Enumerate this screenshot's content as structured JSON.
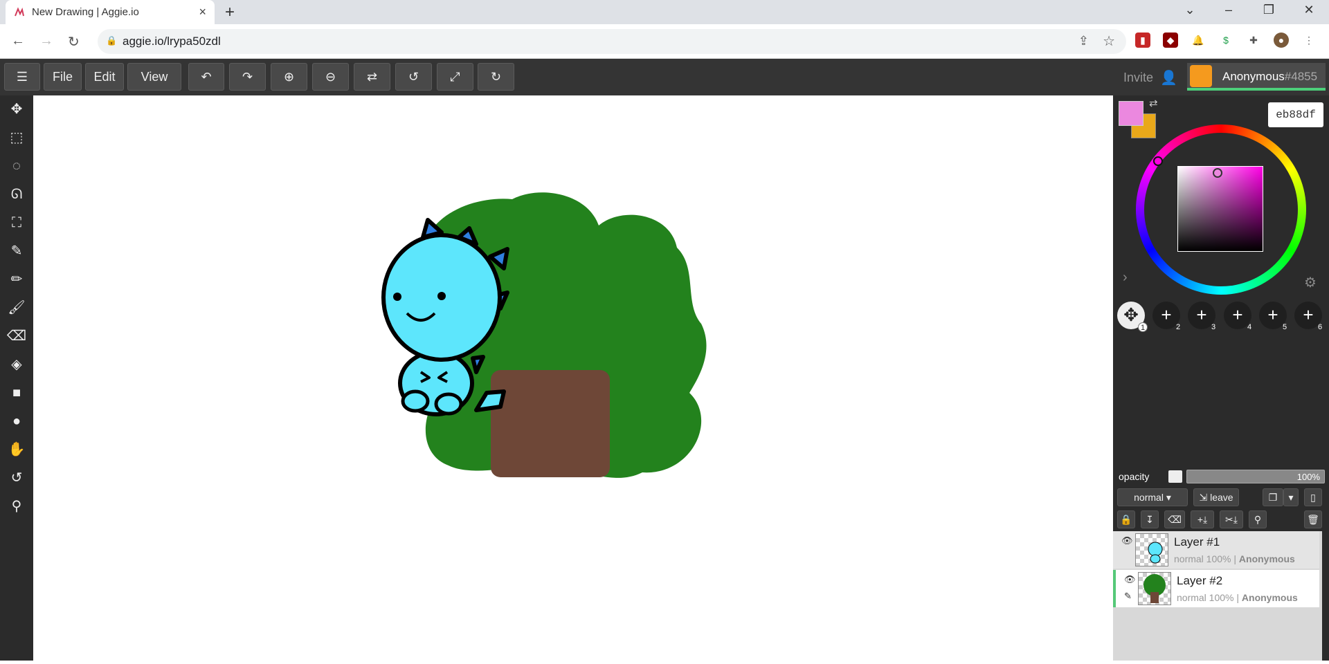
{
  "browser": {
    "tab_title": "New Drawing | Aggie.io",
    "tab_close": "×",
    "new_tab": "+",
    "window_controls": [
      "⌄",
      "–",
      "❐",
      "✕"
    ],
    "url": "aggie.io/lrypa50zdl"
  },
  "toolbar": {
    "menu_icon": "☰",
    "file": "File",
    "edit": "Edit",
    "view": "View",
    "undo": "↶",
    "redo": "↷",
    "zoom_in": "⊕",
    "zoom_out": "⊖",
    "flip": "⇄",
    "rotate_left": "↺",
    "fullscreen": "⤢",
    "rotate_right": "↻",
    "invite": "Invite",
    "user_name": "Anonymous",
    "user_number": "#4855"
  },
  "left_tools": [
    {
      "icon": "move-icon",
      "glyph": "✥"
    },
    {
      "icon": "rect-select-icon",
      "glyph": "⬚"
    },
    {
      "icon": "ellipse-select-icon",
      "glyph": "◌"
    },
    {
      "icon": "lasso-icon",
      "glyph": "ᘏ"
    },
    {
      "icon": "transform-icon",
      "glyph": "⛶"
    },
    {
      "icon": "eyedropper-icon",
      "glyph": "✎"
    },
    {
      "icon": "pencil-icon",
      "glyph": "✏"
    },
    {
      "icon": "brush-icon",
      "glyph": "🖌"
    },
    {
      "icon": "eraser-icon",
      "glyph": "⌫"
    },
    {
      "icon": "fill-icon",
      "glyph": "◈"
    },
    {
      "icon": "rectangle-icon",
      "glyph": "■"
    },
    {
      "icon": "circle-icon",
      "glyph": "●"
    },
    {
      "icon": "hand-icon",
      "glyph": "✋"
    },
    {
      "icon": "reset-icon",
      "glyph": "↺"
    },
    {
      "icon": "zoom-icon",
      "glyph": "⚲"
    }
  ],
  "colors": {
    "primary": "#eb88df",
    "secondary": "#e9a81a",
    "hex": "eb88df"
  },
  "brush_slots": [
    "1",
    "2",
    "3",
    "4",
    "5",
    "6"
  ],
  "opacity": {
    "label": "opacity",
    "value": "100%"
  },
  "layer_controls": {
    "blend_mode": "normal ▾",
    "leave": "leave"
  },
  "layers": [
    {
      "name": "Layer #1",
      "meta_prefix": "normal 100% | ",
      "owner": "Anonymous"
    },
    {
      "name": "Layer #2",
      "meta_prefix": "normal 100% | ",
      "owner": "Anonymous"
    }
  ]
}
